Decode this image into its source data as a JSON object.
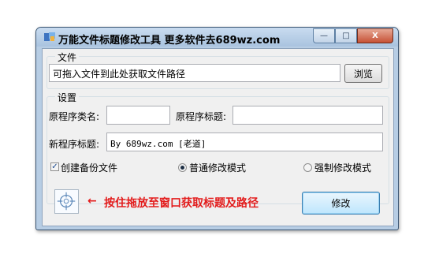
{
  "window": {
    "title": "万能文件标题修改工具  更多软件去689wz.com",
    "controls": {
      "minimize": "—",
      "maximize": "□",
      "close": "X"
    }
  },
  "file_group": {
    "label": "文件",
    "path_value": "可拖入文件到此处获取文件路径",
    "browse_label": "浏览"
  },
  "settings_group": {
    "label": "设置",
    "orig_class_label": "原程序类名:",
    "orig_class_value": "",
    "orig_title_label": "原程序标题:",
    "orig_title_value": "",
    "new_title_label": "新程序标题:",
    "new_title_value": "By 689wz.com [老道]",
    "backup_label": "创建备份文件",
    "backup_checked": true,
    "mode_normal_label": "普通修改模式",
    "mode_normal_selected": true,
    "mode_force_label": "强制修改模式",
    "mode_force_selected": false
  },
  "footer": {
    "hint": "按住拖放至窗口获取标题及路径",
    "modify_label": "修改",
    "arrow": "←",
    "hint_color": "#e31c1c"
  }
}
